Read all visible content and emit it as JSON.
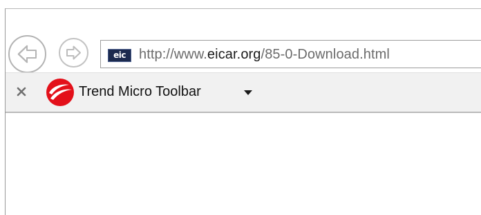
{
  "navigation": {
    "back_icon": "back-arrow-icon",
    "forward_icon": "forward-arrow-icon"
  },
  "address_bar": {
    "site_icon_text": "eic",
    "url_prefix": "http://www.",
    "url_domain": "eicar.org",
    "url_path": "/85-0-Download.html"
  },
  "toolbar": {
    "close_label": "×",
    "logo_icon": "trend-micro-logo-icon",
    "label": "Trend Micro Toolbar",
    "dropdown_icon": "caret-down-icon"
  },
  "colors": {
    "logo_red": "#e3101a",
    "toolbar_bg": "#f1f1f1",
    "site_icon_bg": "#1c2a4e"
  }
}
